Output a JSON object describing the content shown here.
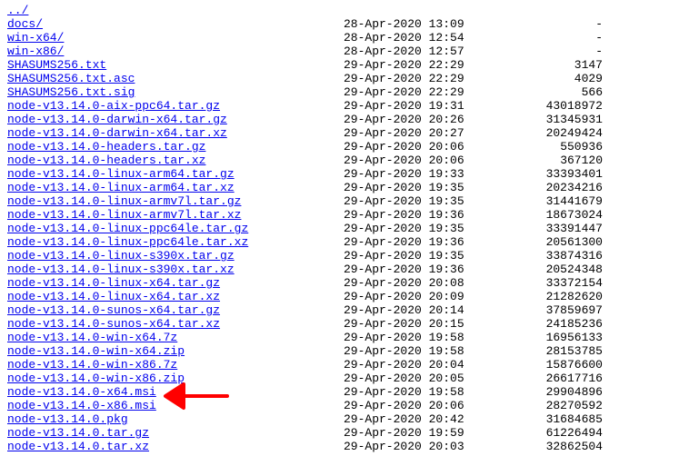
{
  "listing": [
    {
      "name": "../",
      "date": "",
      "size": ""
    },
    {
      "name": "docs/",
      "date": "28-Apr-2020 13:09",
      "size": "-"
    },
    {
      "name": "win-x64/",
      "date": "28-Apr-2020 12:54",
      "size": "-"
    },
    {
      "name": "win-x86/",
      "date": "28-Apr-2020 12:57",
      "size": "-"
    },
    {
      "name": "SHASUMS256.txt",
      "date": "29-Apr-2020 22:29",
      "size": "3147"
    },
    {
      "name": "SHASUMS256.txt.asc",
      "date": "29-Apr-2020 22:29",
      "size": "4029"
    },
    {
      "name": "SHASUMS256.txt.sig",
      "date": "29-Apr-2020 22:29",
      "size": "566"
    },
    {
      "name": "node-v13.14.0-aix-ppc64.tar.gz",
      "date": "29-Apr-2020 19:31",
      "size": "43018972"
    },
    {
      "name": "node-v13.14.0-darwin-x64.tar.gz",
      "date": "29-Apr-2020 20:26",
      "size": "31345931"
    },
    {
      "name": "node-v13.14.0-darwin-x64.tar.xz",
      "date": "29-Apr-2020 20:27",
      "size": "20249424"
    },
    {
      "name": "node-v13.14.0-headers.tar.gz",
      "date": "29-Apr-2020 20:06",
      "size": "550936"
    },
    {
      "name": "node-v13.14.0-headers.tar.xz",
      "date": "29-Apr-2020 20:06",
      "size": "367120"
    },
    {
      "name": "node-v13.14.0-linux-arm64.tar.gz",
      "date": "29-Apr-2020 19:33",
      "size": "33393401"
    },
    {
      "name": "node-v13.14.0-linux-arm64.tar.xz",
      "date": "29-Apr-2020 19:35",
      "size": "20234216"
    },
    {
      "name": "node-v13.14.0-linux-armv7l.tar.gz",
      "date": "29-Apr-2020 19:35",
      "size": "31441679"
    },
    {
      "name": "node-v13.14.0-linux-armv7l.tar.xz",
      "date": "29-Apr-2020 19:36",
      "size": "18673024"
    },
    {
      "name": "node-v13.14.0-linux-ppc64le.tar.gz",
      "date": "29-Apr-2020 19:35",
      "size": "33391447"
    },
    {
      "name": "node-v13.14.0-linux-ppc64le.tar.xz",
      "date": "29-Apr-2020 19:36",
      "size": "20561300"
    },
    {
      "name": "node-v13.14.0-linux-s390x.tar.gz",
      "date": "29-Apr-2020 19:35",
      "size": "33874316"
    },
    {
      "name": "node-v13.14.0-linux-s390x.tar.xz",
      "date": "29-Apr-2020 19:36",
      "size": "20524348"
    },
    {
      "name": "node-v13.14.0-linux-x64.tar.gz",
      "date": "29-Apr-2020 20:08",
      "size": "33372154"
    },
    {
      "name": "node-v13.14.0-linux-x64.tar.xz",
      "date": "29-Apr-2020 20:09",
      "size": "21282620"
    },
    {
      "name": "node-v13.14.0-sunos-x64.tar.gz",
      "date": "29-Apr-2020 20:14",
      "size": "37859697"
    },
    {
      "name": "node-v13.14.0-sunos-x64.tar.xz",
      "date": "29-Apr-2020 20:15",
      "size": "24185236"
    },
    {
      "name": "node-v13.14.0-win-x64.7z",
      "date": "29-Apr-2020 19:58",
      "size": "16956133"
    },
    {
      "name": "node-v13.14.0-win-x64.zip",
      "date": "29-Apr-2020 19:58",
      "size": "28153785"
    },
    {
      "name": "node-v13.14.0-win-x86.7z",
      "date": "29-Apr-2020 20:04",
      "size": "15876600"
    },
    {
      "name": "node-v13.14.0-win-x86.zip",
      "date": "29-Apr-2020 20:05",
      "size": "26617716"
    },
    {
      "name": "node-v13.14.0-x64.msi",
      "date": "29-Apr-2020 19:58",
      "size": "29904896"
    },
    {
      "name": "node-v13.14.0-x86.msi",
      "date": "29-Apr-2020 20:06",
      "size": "28270592"
    },
    {
      "name": "node-v13.14.0.pkg",
      "date": "29-Apr-2020 20:42",
      "size": "31684685"
    },
    {
      "name": "node-v13.14.0.tar.gz",
      "date": "29-Apr-2020 19:59",
      "size": "61226494"
    },
    {
      "name": "node-v13.14.0.tar.xz",
      "date": "29-Apr-2020 20:03",
      "size": "32862504"
    }
  ],
  "annotation": {
    "target_index": 28,
    "color": "#ff0000"
  }
}
